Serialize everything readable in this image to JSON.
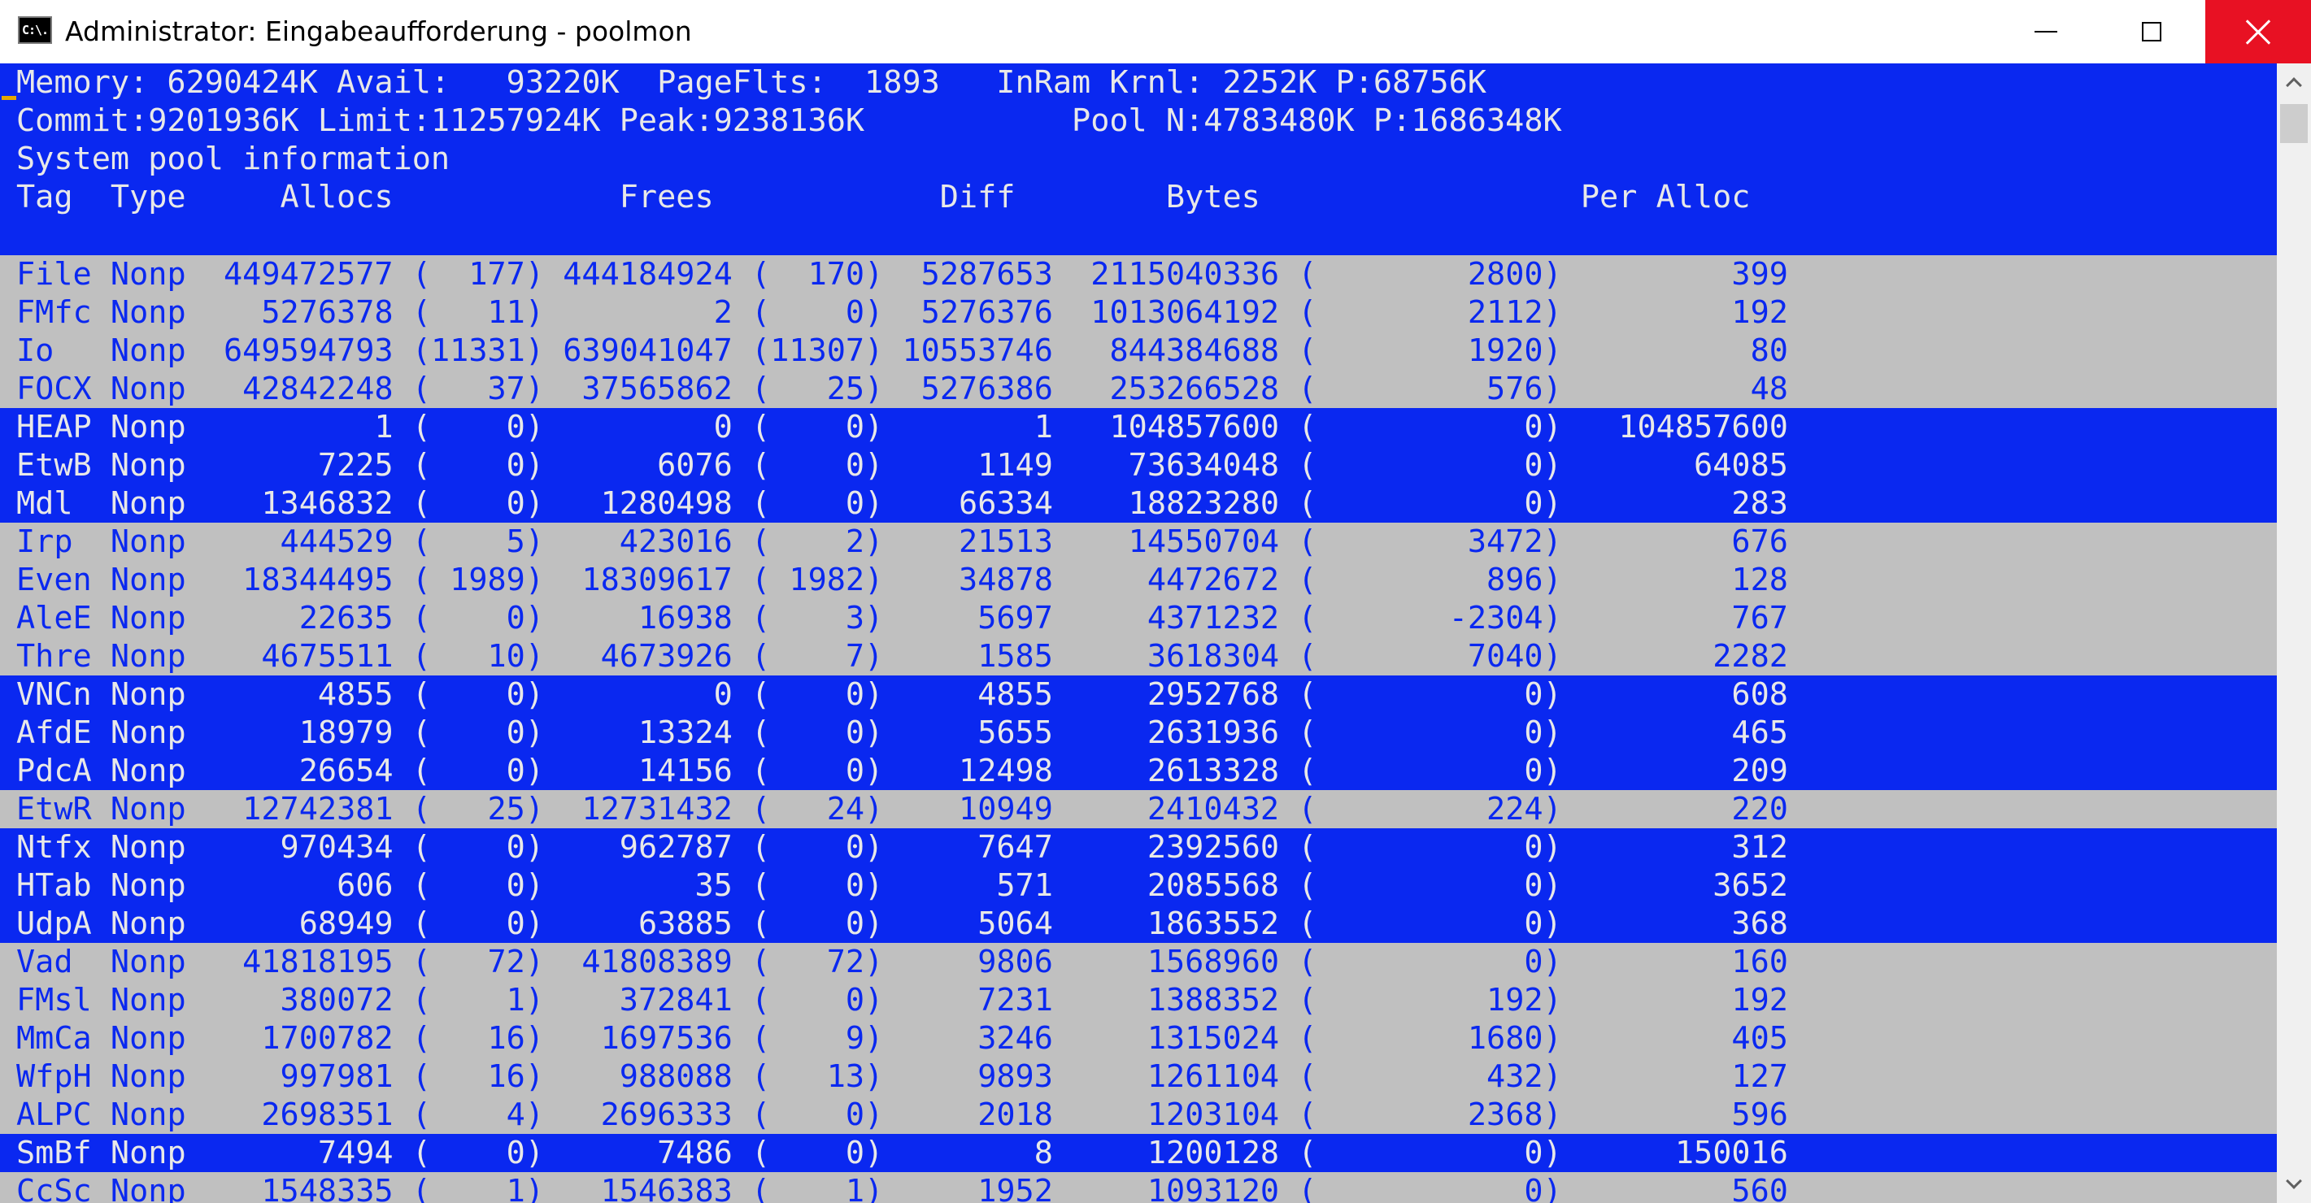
{
  "window": {
    "title": "Administrator: Eingabeaufforderung - poolmon",
    "icon": "command-prompt-icon",
    "icon_text": "C:\\."
  },
  "colors": {
    "console_blue": "#0a28f0",
    "console_grey": "#c0c0c0",
    "close_red": "#e81123"
  },
  "header_lines": [
    "Memory: 6290424K Avail:   93220K  PageFlts:  1893   InRam Krnl: 2252K P:68756K",
    "Commit:9201936K Limit:11257924K Peak:9238136K           Pool N:4783480K P:1686348K",
    "System pool information",
    "Tag  Type     Allocs            Frees            Diff        Bytes                 Per Alloc"
  ],
  "rows": [
    {
      "tag": "File",
      "type": "Nonp",
      "allocs": "449472577",
      "allocs_delta": "177",
      "frees": "444184924",
      "frees_delta": "170",
      "diff": "5287653",
      "bytes": "2115040336",
      "bytes_delta": "2800",
      "per_alloc": "399",
      "highlight": false
    },
    {
      "tag": "FMfc",
      "type": "Nonp",
      "allocs": "5276378",
      "allocs_delta": "11",
      "frees": "2",
      "frees_delta": "0",
      "diff": "5276376",
      "bytes": "1013064192",
      "bytes_delta": "2112",
      "per_alloc": "192",
      "highlight": false
    },
    {
      "tag": "Io  ",
      "type": "Nonp",
      "allocs": "649594793",
      "allocs_delta": "11331",
      "frees": "639041047",
      "frees_delta": "11307",
      "diff": "10553746",
      "bytes": "844384688",
      "bytes_delta": "1920",
      "per_alloc": "80",
      "highlight": false
    },
    {
      "tag": "FOCX",
      "type": "Nonp",
      "allocs": "42842248",
      "allocs_delta": "37",
      "frees": "37565862",
      "frees_delta": "25",
      "diff": "5276386",
      "bytes": "253266528",
      "bytes_delta": "576",
      "per_alloc": "48",
      "highlight": false
    },
    {
      "tag": "HEAP",
      "type": "Nonp",
      "allocs": "1",
      "allocs_delta": "0",
      "frees": "0",
      "frees_delta": "0",
      "diff": "1",
      "bytes": "104857600",
      "bytes_delta": "0",
      "per_alloc": "104857600",
      "highlight": true
    },
    {
      "tag": "EtwB",
      "type": "Nonp",
      "allocs": "7225",
      "allocs_delta": "0",
      "frees": "6076",
      "frees_delta": "0",
      "diff": "1149",
      "bytes": "73634048",
      "bytes_delta": "0",
      "per_alloc": "64085",
      "highlight": true
    },
    {
      "tag": "Mdl ",
      "type": "Nonp",
      "allocs": "1346832",
      "allocs_delta": "0",
      "frees": "1280498",
      "frees_delta": "0",
      "diff": "66334",
      "bytes": "18823280",
      "bytes_delta": "0",
      "per_alloc": "283",
      "highlight": true
    },
    {
      "tag": "Irp ",
      "type": "Nonp",
      "allocs": "444529",
      "allocs_delta": "5",
      "frees": "423016",
      "frees_delta": "2",
      "diff": "21513",
      "bytes": "14550704",
      "bytes_delta": "3472",
      "per_alloc": "676",
      "highlight": false
    },
    {
      "tag": "Even",
      "type": "Nonp",
      "allocs": "18344495",
      "allocs_delta": "1989",
      "frees": "18309617",
      "frees_delta": "1982",
      "diff": "34878",
      "bytes": "4472672",
      "bytes_delta": "896",
      "per_alloc": "128",
      "highlight": false
    },
    {
      "tag": "AleE",
      "type": "Nonp",
      "allocs": "22635",
      "allocs_delta": "0",
      "frees": "16938",
      "frees_delta": "3",
      "diff": "5697",
      "bytes": "4371232",
      "bytes_delta": "-2304",
      "per_alloc": "767",
      "highlight": false
    },
    {
      "tag": "Thre",
      "type": "Nonp",
      "allocs": "4675511",
      "allocs_delta": "10",
      "frees": "4673926",
      "frees_delta": "7",
      "diff": "1585",
      "bytes": "3618304",
      "bytes_delta": "7040",
      "per_alloc": "2282",
      "highlight": false
    },
    {
      "tag": "VNCn",
      "type": "Nonp",
      "allocs": "4855",
      "allocs_delta": "0",
      "frees": "0",
      "frees_delta": "0",
      "diff": "4855",
      "bytes": "2952768",
      "bytes_delta": "0",
      "per_alloc": "608",
      "highlight": true
    },
    {
      "tag": "AfdE",
      "type": "Nonp",
      "allocs": "18979",
      "allocs_delta": "0",
      "frees": "13324",
      "frees_delta": "0",
      "diff": "5655",
      "bytes": "2631936",
      "bytes_delta": "0",
      "per_alloc": "465",
      "highlight": true
    },
    {
      "tag": "PdcA",
      "type": "Nonp",
      "allocs": "26654",
      "allocs_delta": "0",
      "frees": "14156",
      "frees_delta": "0",
      "diff": "12498",
      "bytes": "2613328",
      "bytes_delta": "0",
      "per_alloc": "209",
      "highlight": true
    },
    {
      "tag": "EtwR",
      "type": "Nonp",
      "allocs": "12742381",
      "allocs_delta": "25",
      "frees": "12731432",
      "frees_delta": "24",
      "diff": "10949",
      "bytes": "2410432",
      "bytes_delta": "224",
      "per_alloc": "220",
      "highlight": false
    },
    {
      "tag": "Ntfx",
      "type": "Nonp",
      "allocs": "970434",
      "allocs_delta": "0",
      "frees": "962787",
      "frees_delta": "0",
      "diff": "7647",
      "bytes": "2392560",
      "bytes_delta": "0",
      "per_alloc": "312",
      "highlight": true
    },
    {
      "tag": "HTab",
      "type": "Nonp",
      "allocs": "606",
      "allocs_delta": "0",
      "frees": "35",
      "frees_delta": "0",
      "diff": "571",
      "bytes": "2085568",
      "bytes_delta": "0",
      "per_alloc": "3652",
      "highlight": true
    },
    {
      "tag": "UdpA",
      "type": "Nonp",
      "allocs": "68949",
      "allocs_delta": "0",
      "frees": "63885",
      "frees_delta": "0",
      "diff": "5064",
      "bytes": "1863552",
      "bytes_delta": "0",
      "per_alloc": "368",
      "highlight": true
    },
    {
      "tag": "Vad ",
      "type": "Nonp",
      "allocs": "41818195",
      "allocs_delta": "72",
      "frees": "41808389",
      "frees_delta": "72",
      "diff": "9806",
      "bytes": "1568960",
      "bytes_delta": "0",
      "per_alloc": "160",
      "highlight": false
    },
    {
      "tag": "FMsl",
      "type": "Nonp",
      "allocs": "380072",
      "allocs_delta": "1",
      "frees": "372841",
      "frees_delta": "0",
      "diff": "7231",
      "bytes": "1388352",
      "bytes_delta": "192",
      "per_alloc": "192",
      "highlight": false
    },
    {
      "tag": "MmCa",
      "type": "Nonp",
      "allocs": "1700782",
      "allocs_delta": "16",
      "frees": "1697536",
      "frees_delta": "9",
      "diff": "3246",
      "bytes": "1315024",
      "bytes_delta": "1680",
      "per_alloc": "405",
      "highlight": false
    },
    {
      "tag": "WfpH",
      "type": "Nonp",
      "allocs": "997981",
      "allocs_delta": "16",
      "frees": "988088",
      "frees_delta": "13",
      "diff": "9893",
      "bytes": "1261104",
      "bytes_delta": "432",
      "per_alloc": "127",
      "highlight": false
    },
    {
      "tag": "ALPC",
      "type": "Nonp",
      "allocs": "2698351",
      "allocs_delta": "4",
      "frees": "2696333",
      "frees_delta": "0",
      "diff": "2018",
      "bytes": "1203104",
      "bytes_delta": "2368",
      "per_alloc": "596",
      "highlight": false
    },
    {
      "tag": "SmBf",
      "type": "Nonp",
      "allocs": "7494",
      "allocs_delta": "0",
      "frees": "7486",
      "frees_delta": "0",
      "diff": "8",
      "bytes": "1200128",
      "bytes_delta": "0",
      "per_alloc": "150016",
      "highlight": true
    },
    {
      "tag": "CcSc",
      "type": "Nonp",
      "allocs": "1548335",
      "allocs_delta": "1",
      "frees": "1546383",
      "frees_delta": "1",
      "diff": "1952",
      "bytes": "1093120",
      "bytes_delta": "0",
      "per_alloc": "560",
      "highlight": false
    }
  ]
}
